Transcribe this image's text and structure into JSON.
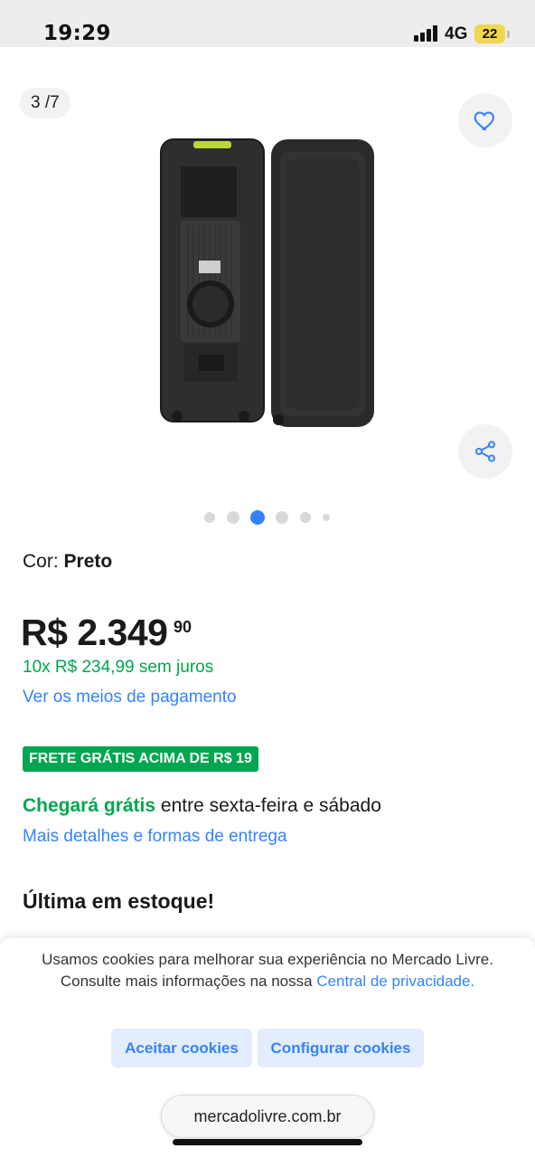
{
  "status_bar": {
    "time": "19:29",
    "network": "4G",
    "battery": "22"
  },
  "gallery": {
    "counter": "3 /7",
    "current_index": 3,
    "total": 7,
    "visible_dots": 6,
    "active_dot": 3
  },
  "product": {
    "color_label": "Cor:",
    "color_value": "Preto",
    "price_currency": "R$",
    "price_int": "2.349",
    "price_cents": "90",
    "installments": "10x R$ 234,99 sem juros",
    "payment_link": "Ver os meios de pagamento",
    "free_shipping_badge": "FRETE GRÁTIS ACIMA DE R$ 19",
    "delivery_highlight": "Chegará grátis",
    "delivery_rest": "entre sexta-feira e sábado",
    "delivery_link": "Mais detalhes e formas de entrega",
    "stock": "Última em estoque!"
  },
  "cookie_banner": {
    "text": "Usamos cookies para melhorar sua experiência no Mercado Livre. Consulte mais informações na nossa",
    "privacy_link": "Central de privacidade.",
    "accept_label": "Aceitar cookies",
    "configure_label": "Configurar cookies"
  },
  "browser": {
    "url": "mercadolivre.com.br"
  },
  "colors": {
    "accent_blue": "#3483fa",
    "green": "#00a650",
    "battery_yellow": "#f1d64f"
  },
  "icons": {
    "favorite": "heart-icon",
    "share": "share-icon",
    "signal": "cellular-signal-icon"
  }
}
